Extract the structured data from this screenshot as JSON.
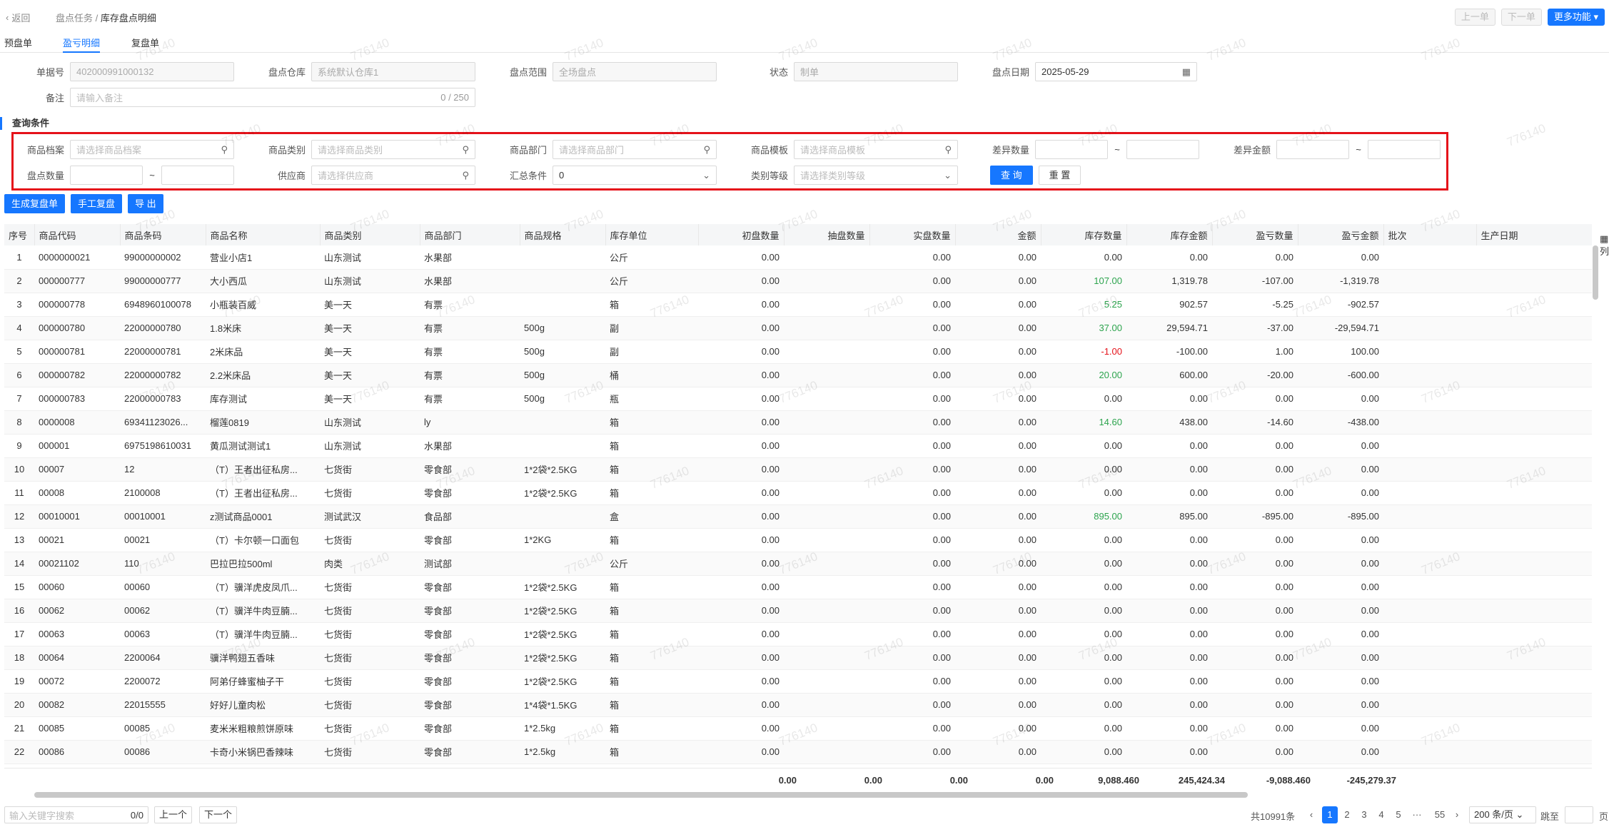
{
  "header": {
    "back": "返回",
    "crumb_parent": "盘点任务",
    "crumb_sep": "/",
    "crumb_current": "库存盘点明细",
    "prev": "上一单",
    "next": "下一单",
    "more": "更多功能"
  },
  "tabs": [
    "预盘单",
    "盈亏明细",
    "复盘单"
  ],
  "form": {
    "doc_no_label": "单据号",
    "doc_no": "402000991000132",
    "warehouse_label": "盘点仓库",
    "warehouse": "系统默认仓库1",
    "scope_label": "盘点范围",
    "scope": "全场盘点",
    "status_label": "状态",
    "status": "制单",
    "date_label": "盘点日期",
    "date": "2025-05-29",
    "remark_label": "备注",
    "remark_ph": "请输入备注",
    "remark_count": "0 / 250"
  },
  "query": {
    "title": "查询条件",
    "goods_label": "商品档案",
    "goods_ph": "请选择商品档案",
    "category_label": "商品类别",
    "category_ph": "请选择商品类别",
    "dept_label": "商品部门",
    "dept_ph": "请选择商品部门",
    "template_label": "商品模板",
    "template_ph": "请选择商品模板",
    "diff_qty_label": "差异数量",
    "diff_amt_label": "差异金额",
    "count_qty_label": "盘点数量",
    "supplier_label": "供应商",
    "supplier_ph": "请选择供应商",
    "sum_label": "汇总条件",
    "sum_value": "0",
    "level_label": "类别等级",
    "level_ph": "请选择类别等级",
    "tilde": "~",
    "search": "查 询",
    "reset": "重 置"
  },
  "actions": [
    "生成复盘单",
    "手工复盘",
    "导 出"
  ],
  "columns": [
    "序号",
    "商品代码",
    "商品条码",
    "商品名称",
    "商品类别",
    "商品部门",
    "商品规格",
    "库存单位",
    "初盘数量",
    "抽盘数量",
    "实盘数量",
    "金额",
    "库存数量",
    "库存金额",
    "盈亏数量",
    "盈亏金额",
    "批次",
    "生产日期"
  ],
  "rows": [
    [
      "1",
      "0000000021",
      "99000000002",
      "营业小店1",
      "山东测试",
      "水果部",
      "",
      "公斤",
      "0.00",
      "",
      "0.00",
      "0.00",
      "0.00",
      "0.00",
      "0.00",
      "0.00"
    ],
    [
      "2",
      "000000777",
      "99000000777",
      "大小西瓜",
      "山东测试",
      "水果部",
      "",
      "公斤",
      "0.00",
      "",
      "0.00",
      "0.00",
      "107.00",
      "1,319.78",
      "-107.00",
      "-1,319.78"
    ],
    [
      "3",
      "000000778",
      "6948960100078",
      "小瓶装百威",
      "美一天",
      "有票",
      "",
      "箱",
      "0.00",
      "",
      "0.00",
      "0.00",
      "5.25",
      "902.57",
      "-5.25",
      "-902.57"
    ],
    [
      "4",
      "000000780",
      "22000000780",
      "1.8米床",
      "美一天",
      "有票",
      "500g",
      "副",
      "0.00",
      "",
      "0.00",
      "0.00",
      "37.00",
      "29,594.71",
      "-37.00",
      "-29,594.71"
    ],
    [
      "5",
      "000000781",
      "22000000781",
      "2米床品",
      "美一天",
      "有票",
      "500g",
      "副",
      "0.00",
      "",
      "0.00",
      "0.00",
      "-1.00",
      "-100.00",
      "1.00",
      "100.00"
    ],
    [
      "6",
      "000000782",
      "22000000782",
      "2.2米床品",
      "美一天",
      "有票",
      "500g",
      "桶",
      "0.00",
      "",
      "0.00",
      "0.00",
      "20.00",
      "600.00",
      "-20.00",
      "-600.00"
    ],
    [
      "7",
      "000000783",
      "22000000783",
      "库存测试",
      "美一天",
      "有票",
      "500g",
      "瓶",
      "0.00",
      "",
      "0.00",
      "0.00",
      "0.00",
      "0.00",
      "0.00",
      "0.00"
    ],
    [
      "8",
      "0000008",
      "69341123026...",
      "榴莲0819",
      "山东测试",
      "ly",
      "",
      "箱",
      "0.00",
      "",
      "0.00",
      "0.00",
      "14.60",
      "438.00",
      "-14.60",
      "-438.00"
    ],
    [
      "9",
      "000001",
      "6975198610031",
      "黄瓜测试测试1",
      "山东测试",
      "水果部",
      "",
      "箱",
      "0.00",
      "",
      "0.00",
      "0.00",
      "0.00",
      "0.00",
      "0.00",
      "0.00"
    ],
    [
      "10",
      "00007",
      "12",
      "（T）王者出征私房...",
      "七货街",
      "零食部",
      "1*2袋*2.5KG",
      "箱",
      "0.00",
      "",
      "0.00",
      "0.00",
      "0.00",
      "0.00",
      "0.00",
      "0.00"
    ],
    [
      "11",
      "00008",
      "2100008",
      "（T）王者出征私房...",
      "七货街",
      "零食部",
      "1*2袋*2.5KG",
      "箱",
      "0.00",
      "",
      "0.00",
      "0.00",
      "0.00",
      "0.00",
      "0.00",
      "0.00"
    ],
    [
      "12",
      "00010001",
      "00010001",
      "z测试商品0001",
      "测试武汉",
      "食品部",
      "",
      "盒",
      "0.00",
      "",
      "0.00",
      "0.00",
      "895.00",
      "895.00",
      "-895.00",
      "-895.00"
    ],
    [
      "13",
      "00021",
      "00021",
      "（T）卡尔顿一口面包",
      "七货街",
      "零食部",
      "1*2KG",
      "箱",
      "0.00",
      "",
      "0.00",
      "0.00",
      "0.00",
      "0.00",
      "0.00",
      "0.00"
    ],
    [
      "14",
      "00021102",
      "110",
      "巴拉巴拉500ml",
      "肉类",
      "测试部",
      "",
      "公斤",
      "0.00",
      "",
      "0.00",
      "0.00",
      "0.00",
      "0.00",
      "0.00",
      "0.00"
    ],
    [
      "15",
      "00060",
      "00060",
      "（T）骥洋虎皮凤爪...",
      "七货街",
      "零食部",
      "1*2袋*2.5KG",
      "箱",
      "0.00",
      "",
      "0.00",
      "0.00",
      "0.00",
      "0.00",
      "0.00",
      "0.00"
    ],
    [
      "16",
      "00062",
      "00062",
      "（T）骥洋牛肉豆腩...",
      "七货街",
      "零食部",
      "1*2袋*2.5KG",
      "箱",
      "0.00",
      "",
      "0.00",
      "0.00",
      "0.00",
      "0.00",
      "0.00",
      "0.00"
    ],
    [
      "17",
      "00063",
      "00063",
      "（T）骥洋牛肉豆腩...",
      "七货街",
      "零食部",
      "1*2袋*2.5KG",
      "箱",
      "0.00",
      "",
      "0.00",
      "0.00",
      "0.00",
      "0.00",
      "0.00",
      "0.00"
    ],
    [
      "18",
      "00064",
      "2200064",
      "骥洋鸭翅五香味",
      "七货街",
      "零食部",
      "1*2袋*2.5KG",
      "箱",
      "0.00",
      "",
      "0.00",
      "0.00",
      "0.00",
      "0.00",
      "0.00",
      "0.00"
    ],
    [
      "19",
      "00072",
      "2200072",
      "阿弟仔蜂蜜柚子干",
      "七货街",
      "零食部",
      "1*2袋*2.5KG",
      "箱",
      "0.00",
      "",
      "0.00",
      "0.00",
      "0.00",
      "0.00",
      "0.00",
      "0.00"
    ],
    [
      "20",
      "00082",
      "22015555",
      "好好儿童肉松",
      "七货街",
      "零食部",
      "1*4袋*1.5KG",
      "箱",
      "0.00",
      "",
      "0.00",
      "0.00",
      "0.00",
      "0.00",
      "0.00",
      "0.00"
    ],
    [
      "21",
      "00085",
      "00085",
      "麦米米粗粮煎饼原味",
      "七货街",
      "零食部",
      "1*2.5kg",
      "箱",
      "0.00",
      "",
      "0.00",
      "0.00",
      "0.00",
      "0.00",
      "0.00",
      "0.00"
    ],
    [
      "22",
      "00086",
      "00086",
      "卡奇小米锅巴香辣味",
      "七货街",
      "零食部",
      "1*2.5kg",
      "箱",
      "0.00",
      "",
      "0.00",
      "0.00",
      "0.00",
      "0.00",
      "0.00",
      "0.00"
    ]
  ],
  "highlight_colors": {
    "positive_stock": "#2da44e",
    "negative_stock": "#e5121a"
  },
  "totals": {
    "init": "0.00",
    "sample": "0.00",
    "actual": "0.00",
    "amount": "0.00",
    "stock": "9,088.460",
    "stock_amt": "245,424.34",
    "pl_qty": "-9,088.460",
    "pl_amt": "-245,279.37"
  },
  "colset": [
    "列"
  ],
  "footer": {
    "search_ph": "输入关键字搜索",
    "search_count": "0/0",
    "prev": "上一个",
    "next": "下一个",
    "total": "共10991条",
    "pages": [
      "1",
      "2",
      "3",
      "4",
      "5",
      "···",
      "55"
    ],
    "page_size": "200 条/页",
    "jump_label": "跳至",
    "page_suffix": "页"
  },
  "watermark": "776140"
}
